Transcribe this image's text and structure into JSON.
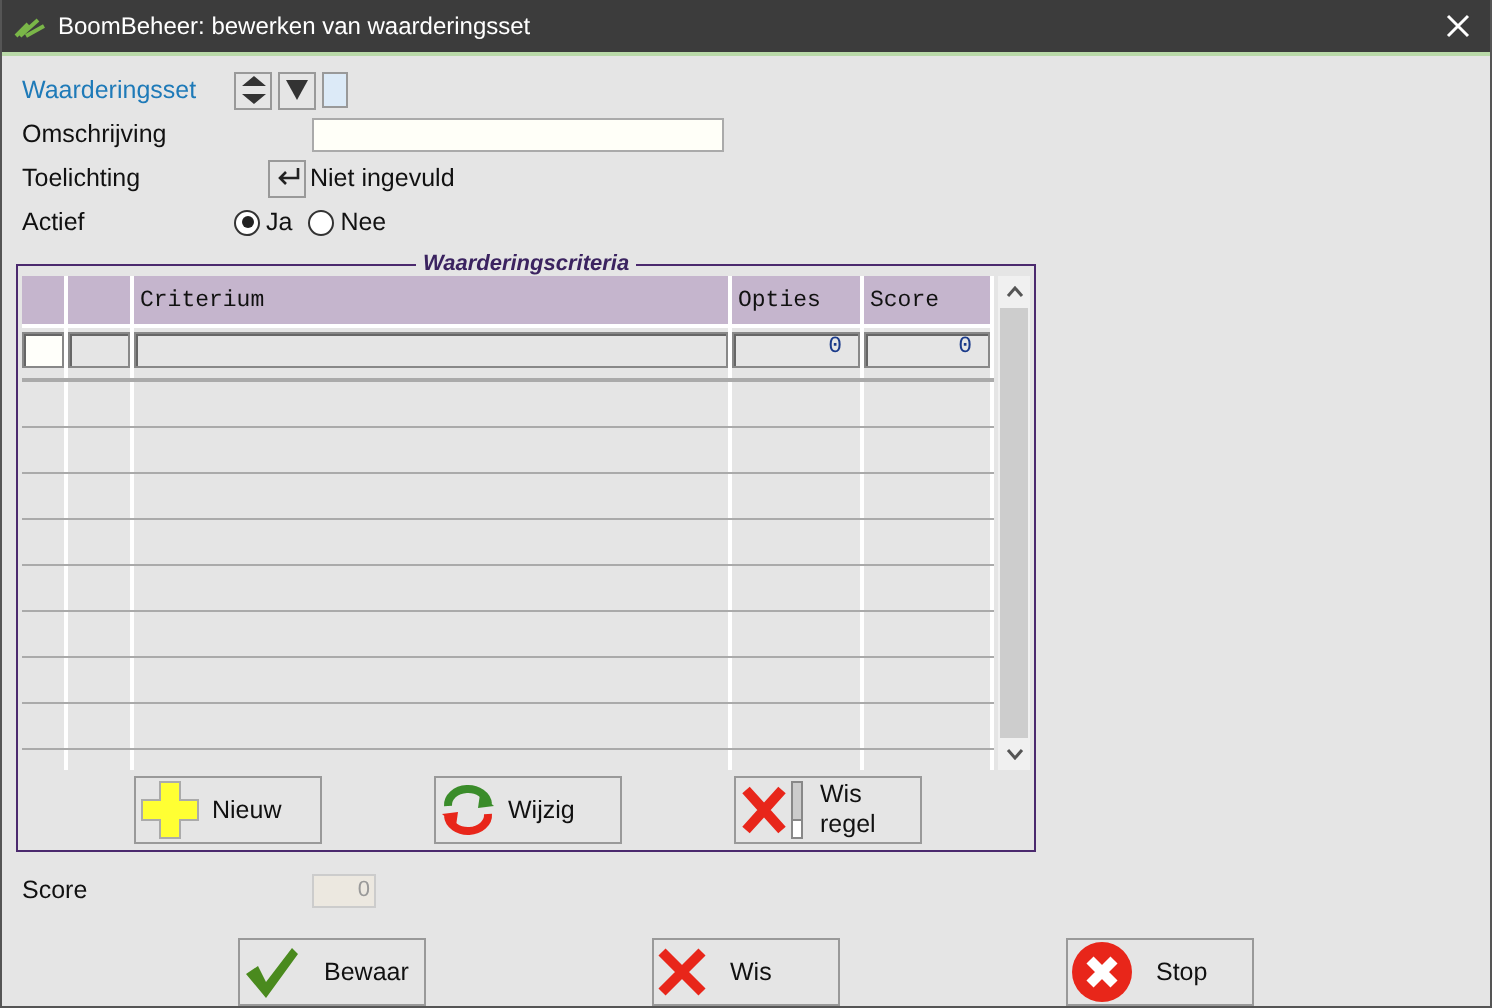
{
  "window": {
    "title": "BoomBeheer: bewerken van waarderingsset"
  },
  "form": {
    "waarderingsset_label": "Waarderingsset",
    "omschrijving_label": "Omschrijving",
    "toelichting_label": "Toelichting",
    "toelichting_value": "Niet ingevuld",
    "actief_label": "Actief",
    "actief_options": [
      {
        "label": "Ja",
        "selected": true
      },
      {
        "label": "Nee",
        "selected": false
      }
    ]
  },
  "criteria": {
    "title": "Waarderingscriteria",
    "columns": [
      "Criterium",
      "Opties",
      "Score"
    ],
    "rows": [
      {
        "criterium": "",
        "opties": "0",
        "score": "0"
      }
    ],
    "buttons": [
      {
        "kind": "plus",
        "label": "Nieuw"
      },
      {
        "kind": "refresh",
        "label": "Wijzig"
      },
      {
        "kind": "delete-row",
        "label": "Wis regel"
      }
    ]
  },
  "score": {
    "label": "Score",
    "value": "0",
    "disabled": true
  },
  "buttons": [
    {
      "kind": "check",
      "label": "Bewaar"
    },
    {
      "kind": "cross",
      "label": "Wis"
    },
    {
      "kind": "stop",
      "label": "Stop"
    }
  ]
}
